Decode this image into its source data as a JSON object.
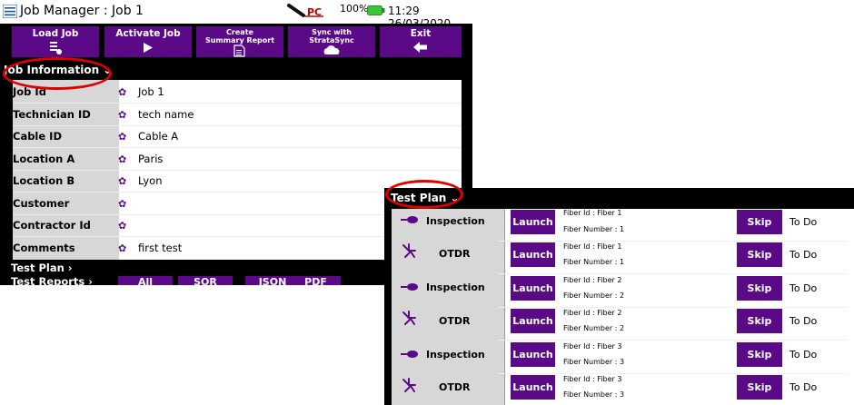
{
  "titlebar": {
    "title": "Job Manager : Job 1",
    "battery_percent": "100%",
    "battery_level": 1.0,
    "time": "11:29",
    "date": "26/03/2020",
    "clock_text": "11:29 26/03/2020",
    "icons": [
      "hamburger-menu-icon",
      "probe-connector-icon",
      "battery-icon"
    ]
  },
  "toolbar": {
    "load_job": "Load Job",
    "activate_job": "Activate Job",
    "create_report_line1": "Create",
    "create_report_line2": "Summary Report",
    "sync_line1": "Sync with",
    "sync_line2": "StrataSync",
    "exit": "Exit"
  },
  "job_information": {
    "heading": "Job Information ⌄",
    "rows": [
      {
        "label": "Job Id",
        "value": "Job 1"
      },
      {
        "label": "Technician ID",
        "value": "tech name"
      },
      {
        "label": "Cable ID",
        "value": "Cable A"
      },
      {
        "label": "Location A",
        "value": "Paris"
      },
      {
        "label": "Location B",
        "value": "Lyon"
      },
      {
        "label": "Customer",
        "value": ""
      },
      {
        "label": "Contractor Id",
        "value": ""
      },
      {
        "label": "Comments",
        "value": "first test"
      }
    ]
  },
  "bottom": {
    "test_plan": "Test Plan ›",
    "test_reports": "Test Reports ›",
    "report_buttons": [
      "All",
      "SOR",
      "JSON",
      "PDF"
    ]
  },
  "test_plan_panel": {
    "heading": "Test Plan ⌄",
    "launch_label": "Launch",
    "skip_label": "Skip",
    "rows": [
      {
        "type": "Inspection",
        "icon": "inspection-probe-icon",
        "fiber_id": "Fiber Id : Fiber 1",
        "fiber_number": "Fiber Number : 1",
        "status": "To Do"
      },
      {
        "type": "OTDR",
        "icon": "otdr-icon",
        "fiber_id": "Fiber Id : Fiber 1",
        "fiber_number": "Fiber Number : 1",
        "status": "To Do"
      },
      {
        "type": "Inspection",
        "icon": "inspection-probe-icon",
        "fiber_id": "Fiber Id : Fiber 2",
        "fiber_number": "Fiber Number : 2",
        "status": "To Do"
      },
      {
        "type": "OTDR",
        "icon": "otdr-icon",
        "fiber_id": "Fiber Id : Fiber 2",
        "fiber_number": "Fiber Number : 2",
        "status": "To Do"
      },
      {
        "type": "Inspection",
        "icon": "inspection-probe-icon",
        "fiber_id": "Fiber Id : Fiber 3",
        "fiber_number": "Fiber Number : 3",
        "status": "To Do"
      },
      {
        "type": "OTDR",
        "icon": "otdr-icon",
        "fiber_id": "Fiber Id : Fiber 3",
        "fiber_number": "Fiber Number : 3",
        "status": "To Do"
      }
    ]
  },
  "colors": {
    "accent_purple": "#5b0a87",
    "highlight_red": "#e00000",
    "battery_green": "#3cc43c",
    "label_column_gray": "#d7d7d7"
  }
}
